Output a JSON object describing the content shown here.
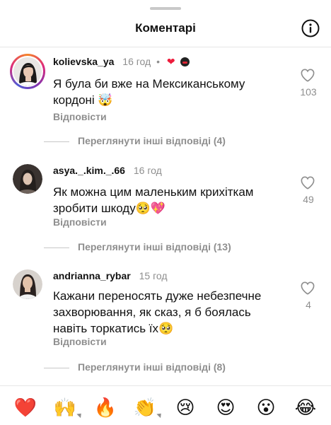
{
  "header": {
    "title": "Коментарі",
    "info_icon": "info-circle-icon"
  },
  "comments": [
    {
      "username": "kolievska_ya",
      "time": "16 год",
      "dot": "•",
      "liked_by_author": true,
      "text": "Я була би вже на Мексиканському кордоні 🤯",
      "reply_label": "Відповісти",
      "like_count": "103",
      "view_replies": "Переглянути інші відповіді (4)"
    },
    {
      "username": "asya._.kim._.66",
      "time": "16 год",
      "text": "Як можна цим маленьким крихіткам зробити шкоду🥺💖",
      "reply_label": "Відповісти",
      "like_count": "49",
      "view_replies": "Переглянути інші відповіді (13)"
    },
    {
      "username": "andrianna_rybar",
      "time": "15 год",
      "text": "Кажани переносять дуже небезпечне захворювання, як сказ, я б боялась навіть торкатись їх🥺",
      "reply_label": "Відповісти",
      "like_count": "4",
      "view_replies": "Переглянути інші відповіді (8)"
    }
  ],
  "reactions": [
    {
      "emoji": "❤️",
      "name": "red-heart"
    },
    {
      "emoji": "🙌",
      "name": "raising-hands"
    },
    {
      "emoji": "🔥",
      "name": "fire"
    },
    {
      "emoji": "👏",
      "name": "clapping-hands"
    },
    {
      "emoji": "😢",
      "name": "crying-face"
    },
    {
      "emoji": "😍",
      "name": "heart-eyes"
    },
    {
      "emoji": "😮",
      "name": "open-mouth"
    },
    {
      "emoji": "😂",
      "name": "tears-of-joy"
    }
  ],
  "colors": {
    "accent_heart": "#ed1c3c",
    "secondary_text": "#8e8e8e"
  }
}
